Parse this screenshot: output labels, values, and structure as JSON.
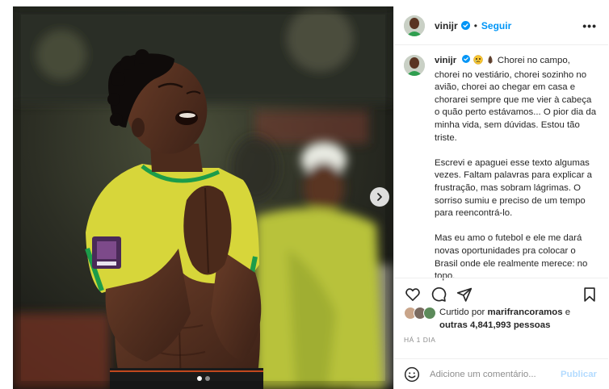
{
  "post": {
    "username": "vinijr",
    "follow_label": "Seguir",
    "separator": "•",
    "more_label": "•••"
  },
  "caption": {
    "username": "vinijr",
    "emojis": [
      "face-holding-back-tears-emoji",
      "folded-hands-emoji"
    ],
    "paragraph1": "Chorei no campo, chorei no vestiário, chorei sozinho no avião, chorei ao chegar em casa e chorarei sempre que me vier à cabeça o quão perto estávamos... O pior dia da minha vida, sem dúvidas. Estou tão triste.",
    "paragraph2": "Escrevi e apaguei esse texto algumas vezes. Faltam palavras para explicar a frustração, mas sobram lágrimas. O sorriso sumiu e preciso de um tempo para reencontrá-lo.",
    "paragraph3": "Mas eu amo o futebol e ele me dará novas oportunidades pra colocar o Brasil onde ele realmente merece: no topo."
  },
  "actions": {
    "icons": [
      "heart-icon",
      "comment-icon",
      "share-icon",
      "bookmark-icon"
    ]
  },
  "likes": {
    "prefix": "Curtido por ",
    "liker": "marifrancoramos",
    "middle": " e",
    "others": "outras 4,841,993 pessoas"
  },
  "time_ago": "HÁ 1 DIA",
  "comment": {
    "placeholder": "Adicione um comentário...",
    "post_label": "Publicar"
  },
  "carousel": {
    "slide_count": 2,
    "active_index": 0
  },
  "colors": {
    "accent": "#0095f6",
    "post_disabled": "#b3dbff",
    "jersey_yellow": "#d7d63a",
    "jersey_green": "#1c9c4a",
    "muted_text": "#8e8e8e"
  }
}
